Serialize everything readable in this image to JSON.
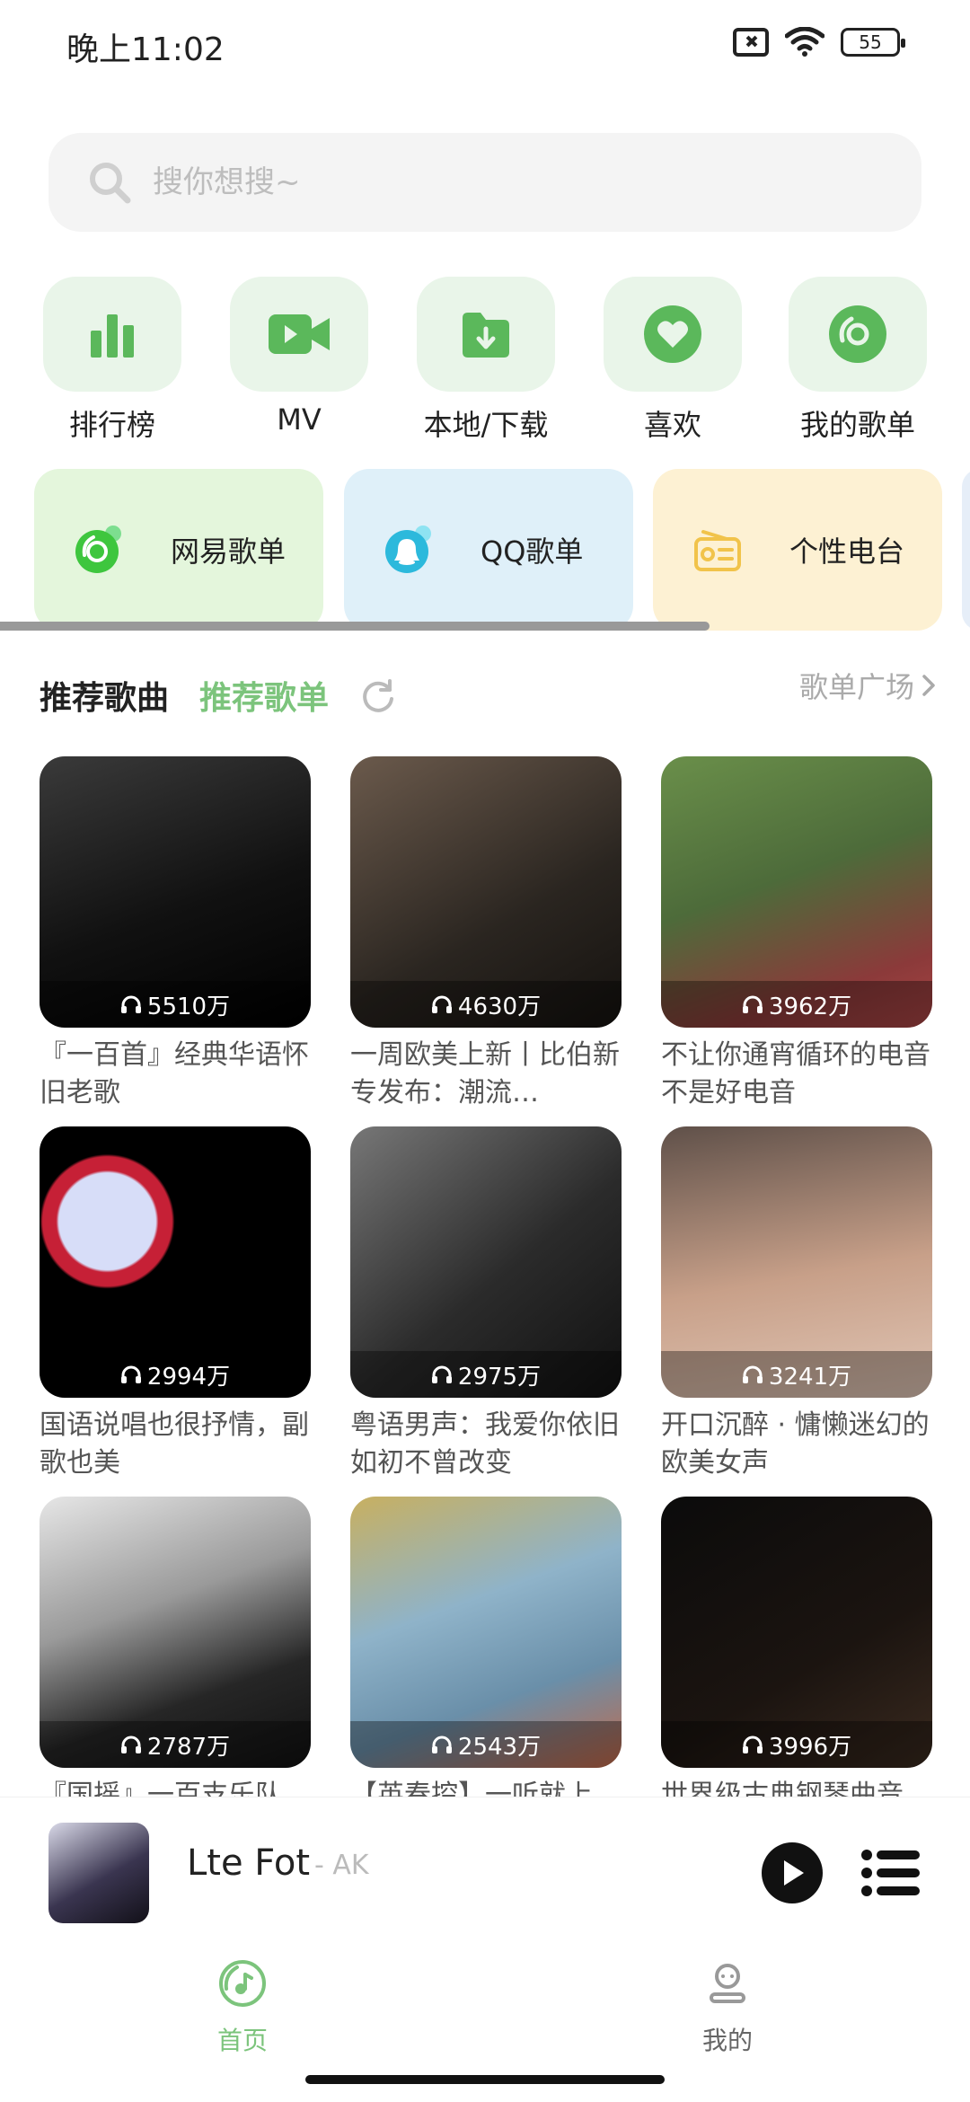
{
  "status_bar": {
    "time": "晚上11:02",
    "battery": "55"
  },
  "search": {
    "placeholder": "搜你想搜~"
  },
  "quick_entries": [
    {
      "label": "排行榜",
      "icon": "bar-chart-icon"
    },
    {
      "label": "MV",
      "icon": "video-icon"
    },
    {
      "label": "本地/下载",
      "icon": "download-folder-icon"
    },
    {
      "label": "喜欢",
      "icon": "heart-icon"
    },
    {
      "label": "我的歌单",
      "icon": "disc-icon"
    }
  ],
  "sources": [
    {
      "label": "网易歌单",
      "icon": "netease-icon"
    },
    {
      "label": "QQ歌单",
      "icon": "qq-icon"
    },
    {
      "label": "个性电台",
      "icon": "radio-icon"
    }
  ],
  "section": {
    "tab_songs": "推荐歌曲",
    "tab_playlists": "推荐歌单",
    "more": "歌单广场"
  },
  "playlists": [
    {
      "plays": "5510万",
      "title": "『一百首』经典华语怀旧老歌"
    },
    {
      "plays": "4630万",
      "title": "一周欧美上新丨比伯新专发布：潮流…"
    },
    {
      "plays": "3962万",
      "title": "不让你通宵循环的电音不是好电音"
    },
    {
      "plays": "2994万",
      "title": "国语说唱也很抒情，副歌也美"
    },
    {
      "plays": "2975万",
      "title": "粤语男声：我爱你依旧如初不曾改变"
    },
    {
      "plays": "3241万",
      "title": "开口沉醉 · 慵懒迷幻的欧美女声"
    },
    {
      "plays": "2787万",
      "title": "『国摇』一百支乐队"
    },
    {
      "plays": "2543万",
      "title": "【英春控】一听就上"
    },
    {
      "plays": "3996万",
      "title": "世界级古典钢琴曲音"
    }
  ],
  "player": {
    "title": "Lte Fot",
    "artist": "- AK"
  },
  "nav": {
    "home": "首页",
    "mine": "我的"
  },
  "colors": {
    "accent": "#7cc47c",
    "icon_green": "#5bb85b",
    "tile_bg": "#e9f5e9"
  }
}
